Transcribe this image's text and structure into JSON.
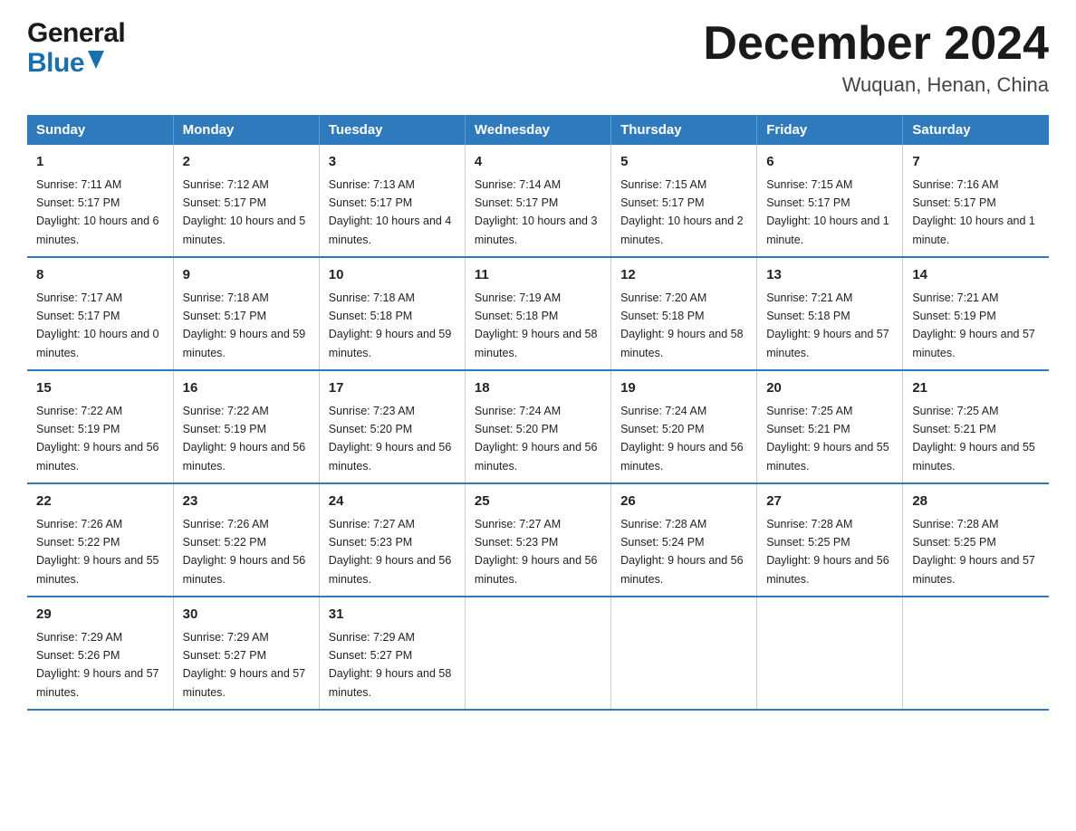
{
  "logo": {
    "general": "General",
    "blue": "Blue"
  },
  "title": "December 2024",
  "subtitle": "Wuquan, Henan, China",
  "days_of_week": [
    "Sunday",
    "Monday",
    "Tuesday",
    "Wednesday",
    "Thursday",
    "Friday",
    "Saturday"
  ],
  "weeks": [
    [
      {
        "day": "1",
        "sunrise": "7:11 AM",
        "sunset": "5:17 PM",
        "daylight": "10 hours and 6 minutes."
      },
      {
        "day": "2",
        "sunrise": "7:12 AM",
        "sunset": "5:17 PM",
        "daylight": "10 hours and 5 minutes."
      },
      {
        "day": "3",
        "sunrise": "7:13 AM",
        "sunset": "5:17 PM",
        "daylight": "10 hours and 4 minutes."
      },
      {
        "day": "4",
        "sunrise": "7:14 AM",
        "sunset": "5:17 PM",
        "daylight": "10 hours and 3 minutes."
      },
      {
        "day": "5",
        "sunrise": "7:15 AM",
        "sunset": "5:17 PM",
        "daylight": "10 hours and 2 minutes."
      },
      {
        "day": "6",
        "sunrise": "7:15 AM",
        "sunset": "5:17 PM",
        "daylight": "10 hours and 1 minute."
      },
      {
        "day": "7",
        "sunrise": "7:16 AM",
        "sunset": "5:17 PM",
        "daylight": "10 hours and 1 minute."
      }
    ],
    [
      {
        "day": "8",
        "sunrise": "7:17 AM",
        "sunset": "5:17 PM",
        "daylight": "10 hours and 0 minutes."
      },
      {
        "day": "9",
        "sunrise": "7:18 AM",
        "sunset": "5:17 PM",
        "daylight": "9 hours and 59 minutes."
      },
      {
        "day": "10",
        "sunrise": "7:18 AM",
        "sunset": "5:18 PM",
        "daylight": "9 hours and 59 minutes."
      },
      {
        "day": "11",
        "sunrise": "7:19 AM",
        "sunset": "5:18 PM",
        "daylight": "9 hours and 58 minutes."
      },
      {
        "day": "12",
        "sunrise": "7:20 AM",
        "sunset": "5:18 PM",
        "daylight": "9 hours and 58 minutes."
      },
      {
        "day": "13",
        "sunrise": "7:21 AM",
        "sunset": "5:18 PM",
        "daylight": "9 hours and 57 minutes."
      },
      {
        "day": "14",
        "sunrise": "7:21 AM",
        "sunset": "5:19 PM",
        "daylight": "9 hours and 57 minutes."
      }
    ],
    [
      {
        "day": "15",
        "sunrise": "7:22 AM",
        "sunset": "5:19 PM",
        "daylight": "9 hours and 56 minutes."
      },
      {
        "day": "16",
        "sunrise": "7:22 AM",
        "sunset": "5:19 PM",
        "daylight": "9 hours and 56 minutes."
      },
      {
        "day": "17",
        "sunrise": "7:23 AM",
        "sunset": "5:20 PM",
        "daylight": "9 hours and 56 minutes."
      },
      {
        "day": "18",
        "sunrise": "7:24 AM",
        "sunset": "5:20 PM",
        "daylight": "9 hours and 56 minutes."
      },
      {
        "day": "19",
        "sunrise": "7:24 AM",
        "sunset": "5:20 PM",
        "daylight": "9 hours and 56 minutes."
      },
      {
        "day": "20",
        "sunrise": "7:25 AM",
        "sunset": "5:21 PM",
        "daylight": "9 hours and 55 minutes."
      },
      {
        "day": "21",
        "sunrise": "7:25 AM",
        "sunset": "5:21 PM",
        "daylight": "9 hours and 55 minutes."
      }
    ],
    [
      {
        "day": "22",
        "sunrise": "7:26 AM",
        "sunset": "5:22 PM",
        "daylight": "9 hours and 55 minutes."
      },
      {
        "day": "23",
        "sunrise": "7:26 AM",
        "sunset": "5:22 PM",
        "daylight": "9 hours and 56 minutes."
      },
      {
        "day": "24",
        "sunrise": "7:27 AM",
        "sunset": "5:23 PM",
        "daylight": "9 hours and 56 minutes."
      },
      {
        "day": "25",
        "sunrise": "7:27 AM",
        "sunset": "5:23 PM",
        "daylight": "9 hours and 56 minutes."
      },
      {
        "day": "26",
        "sunrise": "7:28 AM",
        "sunset": "5:24 PM",
        "daylight": "9 hours and 56 minutes."
      },
      {
        "day": "27",
        "sunrise": "7:28 AM",
        "sunset": "5:25 PM",
        "daylight": "9 hours and 56 minutes."
      },
      {
        "day": "28",
        "sunrise": "7:28 AM",
        "sunset": "5:25 PM",
        "daylight": "9 hours and 57 minutes."
      }
    ],
    [
      {
        "day": "29",
        "sunrise": "7:29 AM",
        "sunset": "5:26 PM",
        "daylight": "9 hours and 57 minutes."
      },
      {
        "day": "30",
        "sunrise": "7:29 AM",
        "sunset": "5:27 PM",
        "daylight": "9 hours and 57 minutes."
      },
      {
        "day": "31",
        "sunrise": "7:29 AM",
        "sunset": "5:27 PM",
        "daylight": "9 hours and 58 minutes."
      },
      null,
      null,
      null,
      null
    ]
  ]
}
